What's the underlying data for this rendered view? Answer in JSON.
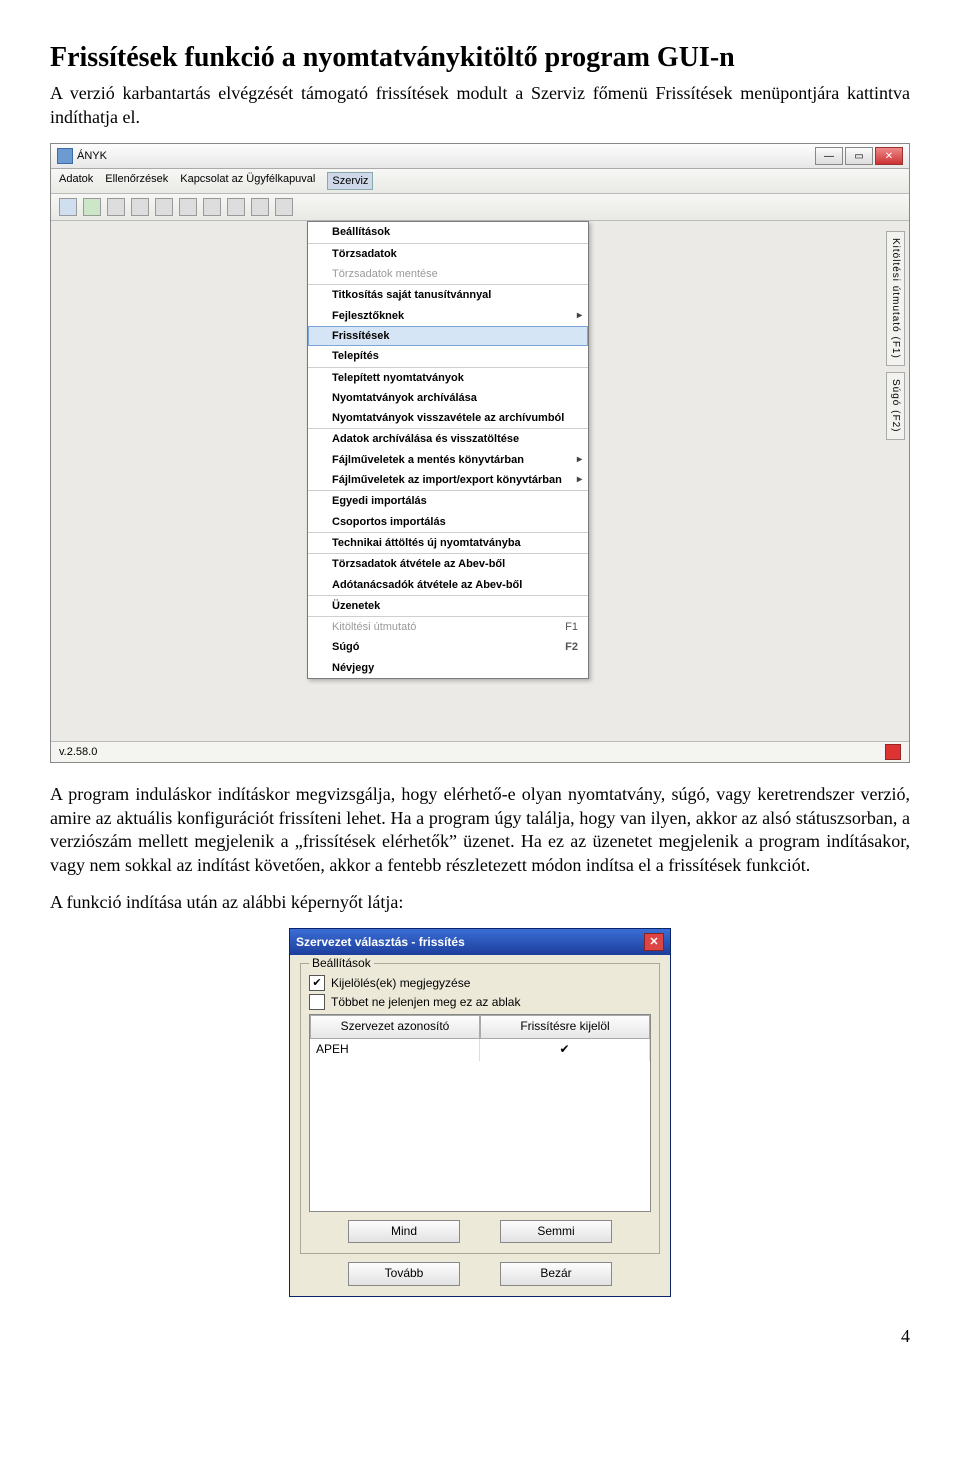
{
  "heading": "Frissítések funkció a nyomtatványkitöltő program GUI-n",
  "intro": "A verzió karbantartás elvégzését támogató frissítések modult a Szerviz főmenü Frissítések menüpontjára kattintva indíthatja el.",
  "app": {
    "title": "ÁNYK",
    "menus": {
      "m1": "Adatok",
      "m2": "Ellenőrzések",
      "m3": "Kapcsolat az Ügyfélkapuval",
      "m4": "Szerviz"
    },
    "dropdown": {
      "i1": "Beállítások",
      "i2": "Törzsadatok",
      "i3": "Törzsadatok mentése",
      "i4": "Titkosítás saját tanusítvánnyal",
      "i5": "Fejlesztőknek",
      "i6": "Frissítések",
      "i7": "Telepítés",
      "i8": "Telepített nyomtatványok",
      "i9": "Nyomtatványok archíválása",
      "i10": "Nyomtatványok visszavétele az archívumból",
      "i11": "Adatok archíválása és visszatöltése",
      "i12": "Fájlműveletek a mentés könyvtárban",
      "i13": "Fájlműveletek az import/export könyvtárban",
      "i14": "Egyedi importálás",
      "i15": "Csoportos importálás",
      "i16": "Technikai áttöltés új nyomtatványba",
      "i17": "Törzsadatok átvétele az Abev-ből",
      "i18": "Adótanácsadók átvétele az Abev-ből",
      "i19": "Üzenetek",
      "i20": "Kitöltési útmutató",
      "i20k": "F1",
      "i21": "Súgó",
      "i21k": "F2",
      "i22": "Névjegy"
    },
    "side": {
      "t1": "Kitöltési útmutató (F1)",
      "t2": "Súgó (F2)"
    },
    "status": "v.2.58.0"
  },
  "para2": "A program induláskor indításkor megvizsgálja, hogy elérhető-e olyan nyomtatvány, súgó, vagy keretrendszer verzió, amire az aktuális konfigurációt frissíteni lehet. Ha a program úgy találja, hogy van ilyen, akkor az alsó státuszsorban, a verziószám mellett megjelenik a „frissítések elérhetők” üzenet. Ha ez az üzenetet megjelenik a program indításakor, vagy nem sokkal az indítást követően, akkor a fentebb részletezett módon indítsa el a frissítések funkciót.",
  "para3": "A funkció indítása után az alábbi képernyőt látja:",
  "dlg": {
    "title": "Szervezet választás - frissítés",
    "group": "Beállítások",
    "cb1": "Kijelölés(ek) megjegyzése",
    "cb2": "Többet ne jelenjen meg ez az ablak",
    "col1": "Szervezet azonosító",
    "col2": "Frissítésre kijelöl",
    "row1": "APEH",
    "row1check": "✔",
    "btn_all": "Mind",
    "btn_none": "Semmi",
    "btn_next": "Tovább",
    "btn_close": "Bezár"
  },
  "pagenum": "4"
}
